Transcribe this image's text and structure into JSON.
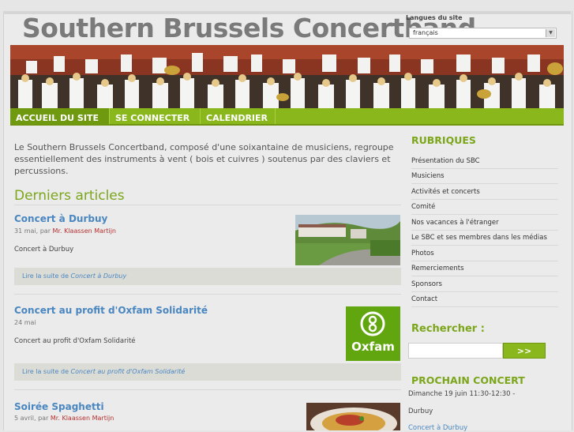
{
  "header": {
    "site_title": "Southern Brussels Concertband",
    "lang_label": "Langues du site",
    "lang_selected": "français"
  },
  "nav": {
    "items": [
      "ACCUEIL DU SITE",
      "SE CONNECTER",
      "CALENDRIER"
    ]
  },
  "intro": "Le Southern Brussels Concertband, composé d'une soixantaine de musiciens, regroupe essentiellement des instruments à vent ( bois et cuivres ) soutenus par des claviers et percussions.",
  "articles": {
    "heading": "Derniers articles",
    "items": [
      {
        "title": "Concert à Durbuy",
        "date": "31 mai, par",
        "author": "Mr. Klaassen Martijn",
        "body": "Concert à Durbuy",
        "readmore_prefix": "Lire la suite de",
        "readmore_link": "Concert à Durbuy"
      },
      {
        "title": "Concert au profit d'Oxfam Solidarité",
        "date": "24 mai",
        "author": "",
        "body": "Concert au profit d'Oxfam Solidarité",
        "readmore_prefix": "Lire la suite de",
        "readmore_link": "Concert au profit d'Oxfam Solidarité"
      },
      {
        "title": "Soirée Spaghetti",
        "date": "5 avril, par",
        "author": "Mr. Klaassen Martijn",
        "body": "",
        "readmore_prefix": "",
        "readmore_link": ""
      }
    ],
    "oxfam_logo_text": "Oxfam"
  },
  "sidebar": {
    "heading": "RUBRIQUES",
    "links": [
      "Présentation du SBC",
      "Musiciens",
      "Activités et concerts",
      "Comité",
      "Nos vacances à l'étranger",
      "Le SBC et ses membres dans les médias",
      "Photos",
      "Remerciements",
      "Sponsors",
      "Contact"
    ],
    "search_heading": "Rechercher :",
    "search_button": ">>",
    "concert_heading": "PROCHAIN CONCERT",
    "concert_date": "Dimanche 19 juin 11:30-12:30 -",
    "concert_place": "Durbuy",
    "concert_link": "Concert à Durbuy"
  },
  "colors": {
    "accent": "#8ab81c",
    "heading_green": "#7ba61a",
    "link_blue": "#4a86c0",
    "author_red": "#b83030"
  }
}
